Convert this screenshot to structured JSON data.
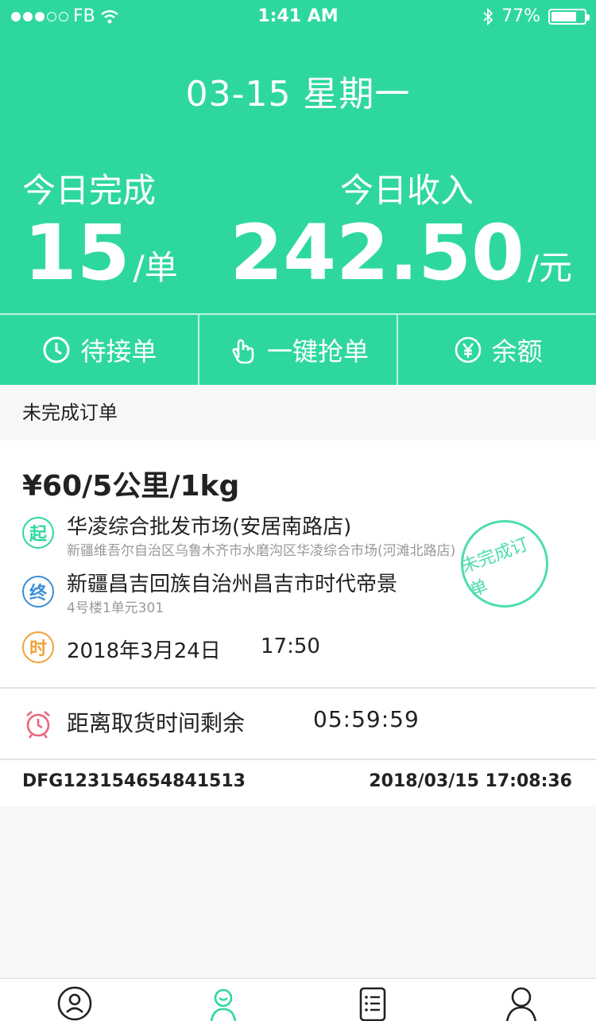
{
  "status_bar": {
    "carrier": "FB",
    "time": "1:41 AM",
    "battery": "77%",
    "battery_level": 0.77
  },
  "header": {
    "date": "03-15 星期一",
    "completed_label": "今日完成",
    "completed_value": "15",
    "completed_unit": "/单",
    "income_label": "今日收入",
    "income_value": "242.50",
    "income_unit": "/元"
  },
  "actions": [
    {
      "label": "待接单",
      "icon": "clock-icon"
    },
    {
      "label": "一键抢单",
      "icon": "tap-hand-icon"
    },
    {
      "label": "余额",
      "icon": "yen-coin-icon"
    }
  ],
  "section_title": "未完成订单",
  "order": {
    "price": "¥60/5公里/1kg",
    "pickup_badge": "起",
    "pickup_name": "华凌综合批发市场(安居南路店)",
    "pickup_address": "新疆维吾尔自治区乌鲁木齐市水磨沟区华凌综合市场(河滩北路店)",
    "dropoff_badge": "终",
    "dropoff_name": "新疆昌吉回族自治州昌吉市时代帝景",
    "dropoff_address": "4号楼1单元301",
    "time_badge": "时",
    "date": "2018年3月24日",
    "time": "17:50",
    "stamp": "未完成订单",
    "remain_label": "距离取货时间剩余",
    "remain_time": "05:59:59",
    "order_no": "DFG123154654841513",
    "order_time": "2018/03/15 17:08:36"
  },
  "colors": {
    "brand": "#2ed89d",
    "pickup": "#2ed89d",
    "dropoff": "#3a8fd6",
    "time": "#f0a13a",
    "alarm": "#e8677c"
  },
  "tabbar": [
    {
      "icon": "user-circle-icon"
    },
    {
      "icon": "courier-icon"
    },
    {
      "icon": "order-list-icon"
    },
    {
      "icon": "profile-icon"
    }
  ]
}
